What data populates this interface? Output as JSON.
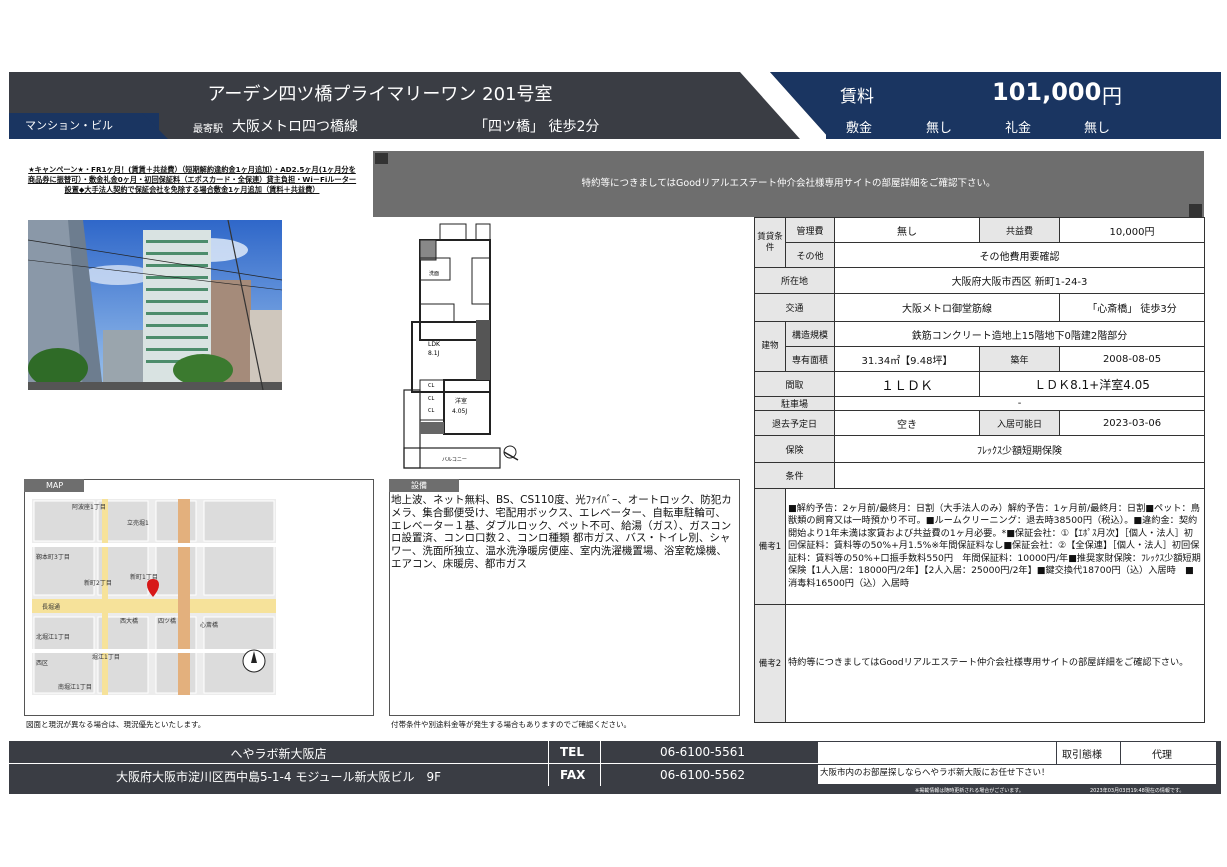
{
  "header": {
    "title": "アーデン四ツ橋プライマリーワン 201号室",
    "type": "マンション・ビル",
    "station_label": "最寄駅",
    "station": "大阪メトロ四つ橋線",
    "walk": "「四ツ橋」 徒歩2分",
    "rent_label": "賃料",
    "rent_value": "101,000",
    "rent_unit": "円",
    "deposit_label": "敷金",
    "deposit_value": "無し",
    "key_money_label": "礼金",
    "key_money_value": "無し"
  },
  "campaign": "★キャンペーン★・FR1ヶ月！(賃賃＋共益費）（短期解約違約金1ヶ月追加）・AD2.5ヶ月(1ヶ月分を商品券に振替可）・敷金礼金0ヶ月・初回保証料（エポスカード・全保連）貸主負担・Wi－Fiルーター設置◆大手法人契約で保証会社を免除する場合敷金1ヶ月追加（賃料＋共益費）",
  "banner": "特約等につきましてはGoodリアルエステート仲介会社様専用サイトの部屋詳細をご確認下さい。",
  "floorplan": {
    "rooms": {
      "wash": "洗面",
      "ldk": "LDK",
      "ldk_size": "8.1J",
      "western": "洋室",
      "western_size": "4.05J",
      "balcony": "バルコニー",
      "cl": "CL"
    }
  },
  "spec": {
    "cond_group": "賃貸条件",
    "mgmt_label": "管理費",
    "mgmt": "無し",
    "common_label": "共益費",
    "common": "10,000円",
    "other_label": "その他",
    "other": "その他費用要確認",
    "address_label": "所在地",
    "address": "大阪府大阪市西区 新町1-24-3",
    "transit_label": "交通",
    "transit_line": "大阪メトロ御堂筋線",
    "transit_walk": "「心斎橋」 徒歩3分",
    "bldg_group": "建物",
    "structure_label": "構造規模",
    "structure": "鉄筋コンクリート造地上15階地下0階建2階部分",
    "area_label": "専有面積",
    "area": "31.34㎡【9.48坪】",
    "age_label": "築年",
    "age": "2008-08-05",
    "layout_label": "間取",
    "layout": "１ＬＤＫ",
    "layout_detail": "ＬＤＫ8.1+洋室4.05",
    "parking_label": "駐車場",
    "parking": "-",
    "moveout_label": "退去予定日",
    "moveout": "空き",
    "movein_label": "入居可能日",
    "movein": "2023-03-06",
    "insurance_label": "保険",
    "insurance": "ﾌﾚｯｸｽ少額短期保険",
    "conditions_label": "条件",
    "conditions": "",
    "remarks1_label": "備考1",
    "remarks1": "■解約予告：2ヶ月前/最終月：日割（大手法人のみ）解約予告：1ヶ月前/最終月：日割■ペット：鳥獣類の飼育又は一時預かり不可。■ルームクリーニング：退去時38500円（税込）。■違約金：契約開始より1年未満は家賃および共益費の1ヶ月必要。*■保証会社：①【ｴﾎﾟｽ月次】［個人・法人］初回保証料：賃料等の50%+月1.5%※年間保証料なし■保証会社：②【全保連】［個人・法人］初回保証料：賃料等の50%+口振手数料550円　年間保証料：10000円/年■推奨家財保険：ﾌﾚｯｸｽ少額短期保険【1人入居：18000円/2年】【2人入居：25000円/2年】■鍵交換代18700円（込）入居時　■消毒料16500円（込）入居時",
    "remarks2_label": "備考2",
    "remarks2": "特約等につきましてはGoodリアルエステート仲介会社様専用サイトの部屋詳細をご確認下さい。"
  },
  "map": {
    "tag": "MAP",
    "labels": [
      "阿波座1丁目",
      "立売堀1",
      "新町2丁目",
      "新町1丁目",
      "西大橋",
      "長堀通",
      "四ツ橋",
      "心斎橋",
      "堀江1丁目",
      "南堀江1丁目",
      "靱本町3丁目",
      "北堀江1丁目",
      "西区"
    ],
    "note": "図面と現況が異なる場合は、現況優先といたします。"
  },
  "facilities": {
    "tag": "設備",
    "text": "地上波、ネット無料、BS、CS110度、光ﾌｧｲﾊﾞｰ、オートロック、防犯カメラ、集合郵便受け、宅配用ボックス、エレベーター、自転車駐輪可、エレベーター１基、ダブルロック、ペット不可、給湯（ガス）、ガスコンロ設置済、コンロ口数２、コンロ種類 都市ガス、バス・トイレ別、シャワー、洗面所独立、温水洗浄暖房便座、室内洗濯機置場、浴室乾燥機、エアコン、床暖房、都市ガス",
    "note": "付帯条件や別途料金等が発生する場合もありますのでご確認ください。"
  },
  "footer": {
    "company": "へやラボ新大阪店",
    "address": "大阪府大阪市淀川区西中島5-1-4 モジュール新大阪ビル　9F",
    "tel_label": "TEL",
    "tel": "06-6100-5561",
    "fax_label": "FAX",
    "fax": "06-6100-5562",
    "deal_label": "取引態様",
    "deal": "代理",
    "message": "大阪市内のお部屋探しならへやラボ新大阪にお任せ下さい！",
    "disclaimer": "※掲載情報は随時更新される場合がございます。",
    "timestamp": "2023年03月03日19:48現在の情報です。"
  }
}
